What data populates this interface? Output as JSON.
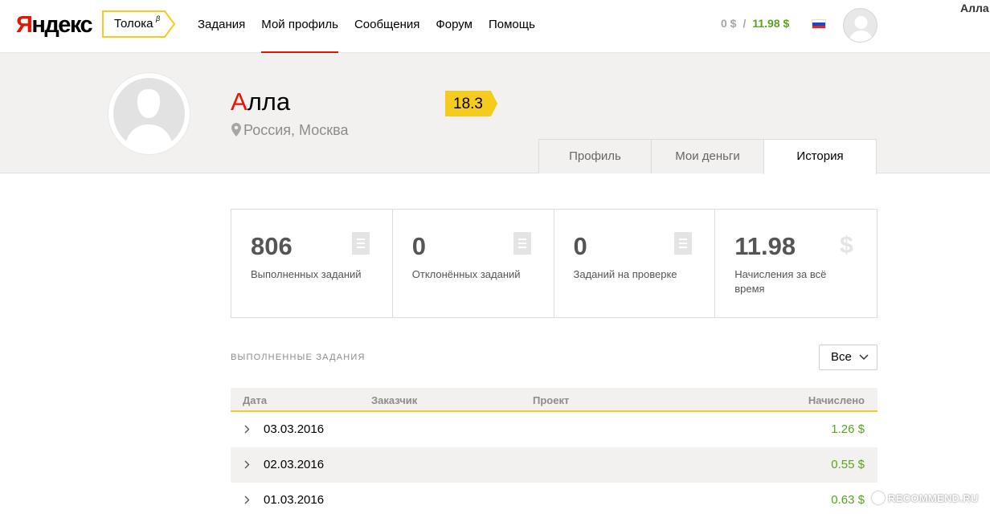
{
  "header": {
    "logo_first": "Я",
    "logo_rest": "ндекс",
    "service_label": "Толока",
    "service_beta": "β",
    "nav": [
      {
        "label": "Задания",
        "active": false
      },
      {
        "label": "Мой профиль",
        "active": true
      },
      {
        "label": "Сообщения",
        "active": false
      },
      {
        "label": "Форум",
        "active": false
      },
      {
        "label": "Помощь",
        "active": false
      }
    ],
    "balance_pending": "0 $",
    "balance_separator": "/",
    "balance_total": "11.98 $",
    "flag_icon": "russia-flag-icon",
    "user_name": "Алла"
  },
  "profile": {
    "name_first_letter": "А",
    "name_rest": "лла",
    "location": "Россия, Москва",
    "rating": "18.3",
    "tabs": [
      {
        "label": "Профиль",
        "active": false
      },
      {
        "label": "Мои деньги",
        "active": false
      },
      {
        "label": "История",
        "active": true
      }
    ]
  },
  "stats": [
    {
      "value": "806",
      "label": "Выполненных заданий",
      "icon": "document-icon"
    },
    {
      "value": "0",
      "label": "Отклонённых заданий",
      "icon": "document-icon"
    },
    {
      "value": "0",
      "label": "Заданий на проверке",
      "icon": "document-icon"
    },
    {
      "value": "11.98",
      "label": "Начисления за всё время",
      "icon": "dollar-icon"
    }
  ],
  "completed": {
    "section_title": "выполненные задания",
    "filter_value": "Все",
    "columns": [
      "Дата",
      "Заказчик",
      "Проект",
      "Начислено"
    ],
    "rows": [
      {
        "date": "03.03.2016",
        "amount": "1.26 $"
      },
      {
        "date": "02.03.2016",
        "amount": "0.55 $"
      },
      {
        "date": "01.03.2016",
        "amount": "0.63 $"
      }
    ]
  },
  "watermark": "RECOMMEND.RU",
  "colors": {
    "accent_red": "#e61400",
    "accent_yellow": "#f5cc1e",
    "money_green": "#5ba31d",
    "band_bg": "#f2f1ef"
  }
}
